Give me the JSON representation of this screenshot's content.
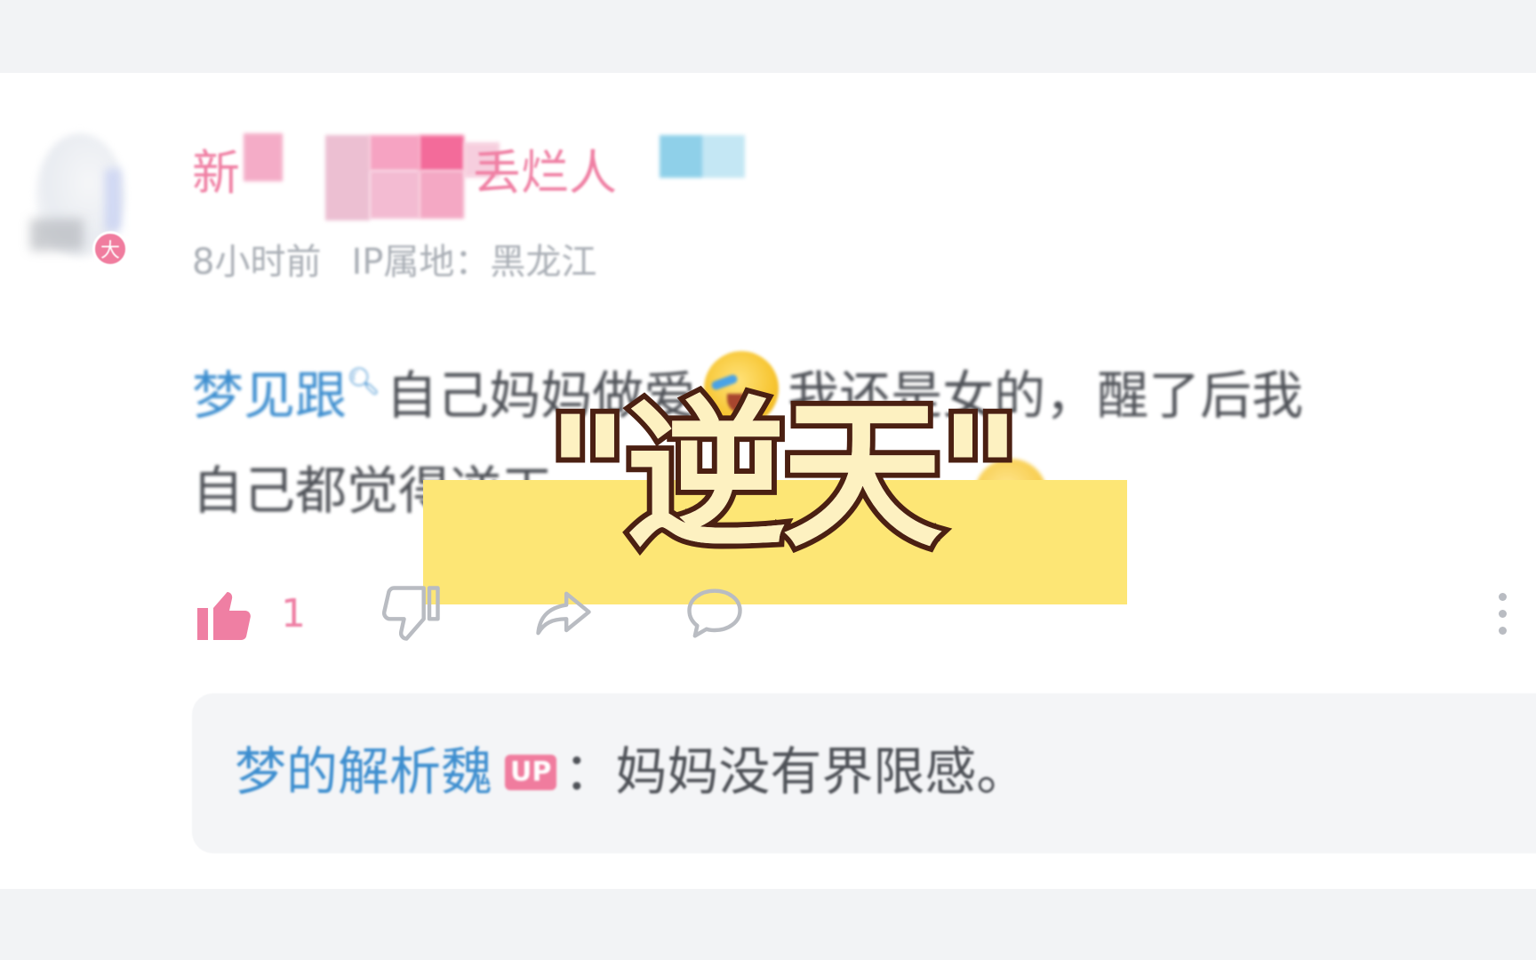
{
  "comment": {
    "username_start": "新",
    "username_end": "丢烂人",
    "time": "8小时前",
    "ip_location": "IP属地：黑龙江",
    "line1_link": "梦见跟",
    "line1_text": "自己妈妈做爱",
    "line1_text2": "我还是女的，醒了后我",
    "line2_text": "自己都觉得逆天",
    "emoji": "laughing-crying-emoji",
    "like_count": "1"
  },
  "overlay": {
    "text": "\"逆天\"",
    "colors": {
      "fill": "#fdf1c1",
      "stroke": "#4b2012",
      "highlight": "#fde675"
    }
  },
  "reply": {
    "name": "梦的解析魏",
    "badge": "UP",
    "text": "：妈妈没有界限感。"
  },
  "colors": {
    "username": "#ef7fa3",
    "link": "#3d8ecf",
    "meta": "#a9aeb5",
    "like": "#ee7fa4"
  },
  "icons": {
    "like": "thumbs-up-icon",
    "dislike": "thumbs-down-icon",
    "share": "share-icon",
    "reply": "reply-icon",
    "more": "more-vertical-icon"
  }
}
